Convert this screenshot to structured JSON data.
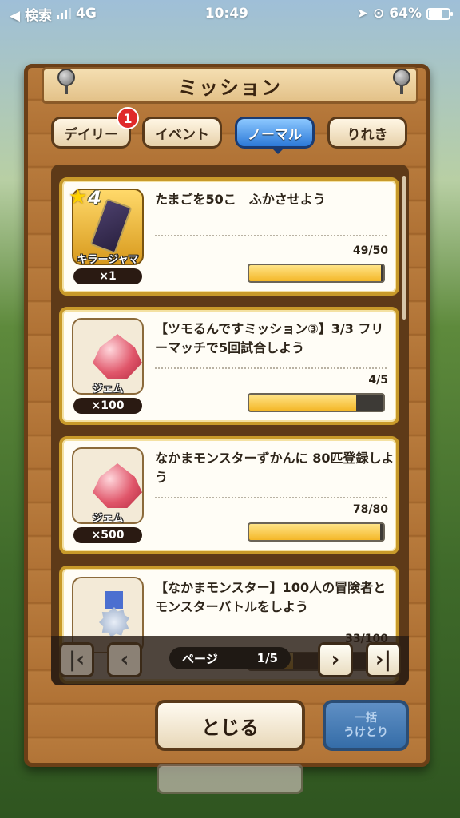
{
  "status_bar": {
    "back_label": "◀ 検索",
    "network": "4G",
    "time": "10:49",
    "battery": "64%"
  },
  "title": "ミッション",
  "tabs": [
    {
      "label": "デイリー",
      "badge": "1"
    },
    {
      "label": "イベント"
    },
    {
      "label": "ノーマル",
      "active": true
    },
    {
      "label": "りれき"
    }
  ],
  "missions": [
    {
      "text": "たまごを50こ　ふかさせよう",
      "reward_name": "キラージャマーδ",
      "reward_qty": "×1",
      "star": "4",
      "count": "49/50",
      "progress": 0.98
    },
    {
      "text": "【ツモるんですミッション③】3/3 フリーマッチで5回試合しよう",
      "reward_name": "ジェム",
      "reward_qty": "×100",
      "count": "4/5",
      "progress": 0.8
    },
    {
      "text": "なかまモンスターずかんに 80匹登録しよう",
      "reward_name": "ジェム",
      "reward_qty": "×500",
      "count": "78/80",
      "progress": 0.975
    },
    {
      "text": "【なかまモンスター】100人の冒険者とモンスターバトルをしよう",
      "count": "33/100",
      "progress": 0.33
    }
  ],
  "pager": {
    "label": "ページ",
    "value": "1/5"
  },
  "buttons": {
    "close": "とじる",
    "claim_line1": "一括",
    "claim_line2": "うけとり"
  }
}
